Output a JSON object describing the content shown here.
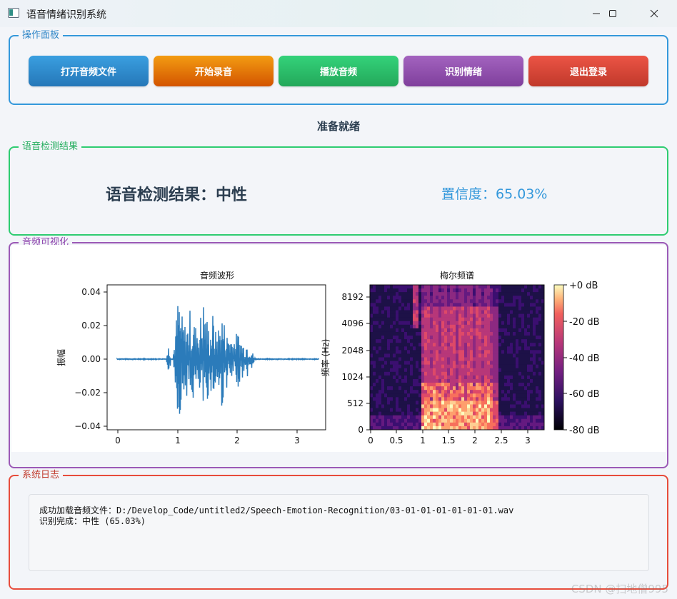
{
  "window": {
    "title": "语音情绪识别系统"
  },
  "ops": {
    "title": "操作面板",
    "buttons": [
      {
        "label": "打开音频文件"
      },
      {
        "label": "开始录音"
      },
      {
        "label": "播放音频"
      },
      {
        "label": "识别情绪"
      },
      {
        "label": "退出登录"
      }
    ]
  },
  "status": "准备就绪",
  "result": {
    "title": "语音检测结果",
    "label": "语音检测结果：中性",
    "confidence": "置信度：65.03%"
  },
  "visual": {
    "title": "音频可视化",
    "waveform": {
      "title": "音频波形",
      "ylabel": "振幅",
      "yticks": [
        "0.04",
        "0.02",
        "0.00",
        "−0.02",
        "−0.04"
      ],
      "xticks": [
        "0",
        "1",
        "2",
        "3"
      ]
    },
    "mel": {
      "title": "梅尔频谱",
      "ylabel": "频率 (Hz)",
      "yticks": [
        "8192",
        "4096",
        "2048",
        "1024",
        "512",
        "0"
      ],
      "xticks": [
        "0",
        "0.5",
        "1",
        "1.5",
        "2",
        "2.5",
        "3"
      ],
      "colorbar": [
        "+0 dB",
        "-20 dB",
        "-40 dB",
        "-60 dB",
        "-80 dB"
      ]
    }
  },
  "log": {
    "title": "系统日志",
    "lines": [
      "成功加载音频文件：D:/Develop_Code/untitled2/Speech-Emotion-Recognition/03-01-01-01-01-01-01.wav",
      "识别完成：中性 (65.03%)"
    ]
  },
  "watermark": "CSDN @扫地僧995",
  "colors": {
    "ops": "#3498db",
    "result": "#2ecc71",
    "visual": "#9b59b6",
    "log": "#e74c3c",
    "wave": "#2b7bba",
    "confidence": "#3498db"
  },
  "icons": [
    "app-icon",
    "minimize-icon",
    "maximize-icon",
    "close-icon"
  ]
}
